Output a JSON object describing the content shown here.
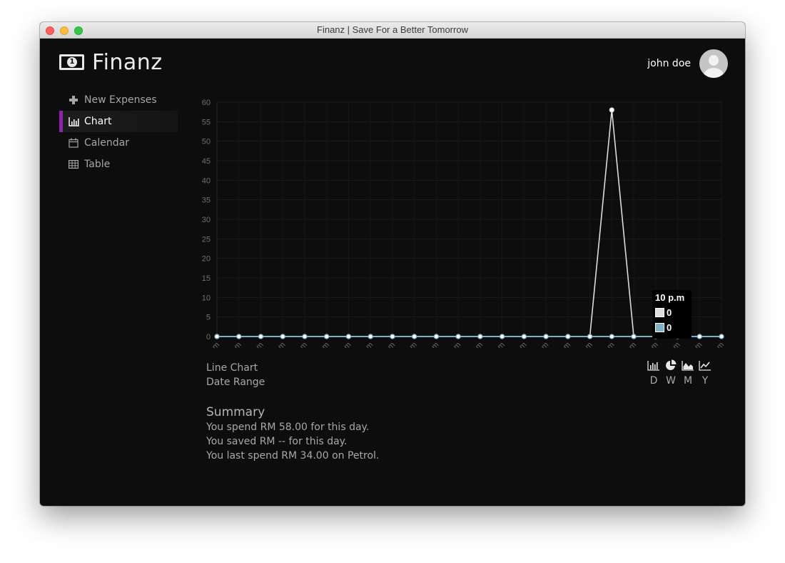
{
  "window": {
    "title": "Finanz | Save For a Better Tomorrow"
  },
  "header": {
    "app_name": "Finanz",
    "logo_icon": "money-bill-icon",
    "user_name": "john doe"
  },
  "sidebar": {
    "items": [
      {
        "label": "New Expenses",
        "icon": "plus-icon",
        "active": false
      },
      {
        "label": "Chart",
        "icon": "bar-chart-icon",
        "active": true
      },
      {
        "label": "Calendar",
        "icon": "calendar-icon",
        "active": false
      },
      {
        "label": "Table",
        "icon": "table-icon",
        "active": false
      }
    ]
  },
  "chart_data": {
    "type": "line",
    "categories": [
      "12 a.m",
      "1 a.m",
      "2 a.m",
      "3 a.m",
      "4 a.m",
      "5 a.m",
      "6 a.m",
      "7 a.m",
      "8 a.m",
      "9 a.m",
      "10 a.m",
      "11 a.m",
      "12 p.m",
      "1 p.m",
      "2 p.m",
      "3 p.m",
      "4 p.m",
      "5 p.m",
      "6 p.m",
      "7 p.m",
      "8 p.m",
      "9 p.m",
      "10 p.m",
      "11 p.m"
    ],
    "series": [
      {
        "values": [
          0,
          0,
          0,
          0,
          0,
          0,
          0,
          0,
          0,
          0,
          0,
          0,
          0,
          0,
          0,
          0,
          0,
          0,
          58,
          0,
          0,
          0,
          0,
          0
        ],
        "color": "#dcdcdc"
      },
      {
        "values": [
          0,
          0,
          0,
          0,
          0,
          0,
          0,
          0,
          0,
          0,
          0,
          0,
          0,
          0,
          0,
          0,
          0,
          0,
          0,
          0,
          0,
          0,
          0,
          0
        ],
        "color": "#7fb0c8"
      }
    ],
    "yticks": [
      0,
      5,
      10,
      15,
      20,
      25,
      30,
      35,
      40,
      45,
      50,
      55,
      60
    ],
    "ylim": [
      0,
      60
    ],
    "grid": true,
    "tooltip": {
      "title": "10 p.m",
      "rows": [
        {
          "value": "0",
          "color": "#dcdcdc"
        },
        {
          "value": "0",
          "color": "#7fb0c8"
        }
      ]
    }
  },
  "chart_info": {
    "type_label": "Line Chart",
    "range_label": "Date Range"
  },
  "chart_types": [
    "bar-chart-icon",
    "pie-chart-icon",
    "area-chart-icon",
    "line-chart-icon"
  ],
  "ranges": [
    "D",
    "W",
    "M",
    "Y"
  ],
  "summary": {
    "title": "Summary",
    "line1": "You spend RM 58.00 for this day.",
    "line2": "You saved RM -- for this day.",
    "line3": "You last spend RM 34.00 on Petrol."
  }
}
